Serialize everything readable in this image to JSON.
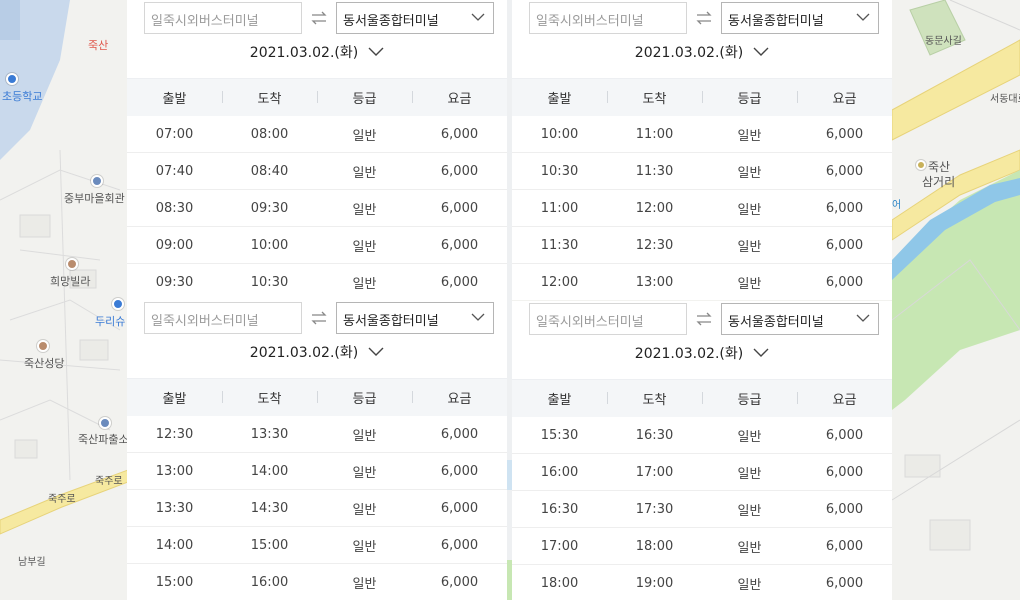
{
  "map": {
    "labels": {
      "school": "초등학교",
      "juksan_red": "죽산",
      "jungbu": "중부마을회관",
      "huimang": "희망빌라",
      "duri": "두리슈",
      "juksan_church": "죽산성당",
      "police": "죽산파출소",
      "jukju_ro_1": "죽주로",
      "jukju_ro_2": "죽주로",
      "nambu": "남부길",
      "dongmun": "동문사길",
      "seodong": "서동대로",
      "samgeori_1": "죽산",
      "samgeori_2": "삼거리",
      "eo": "어"
    }
  },
  "panels": [
    {
      "from_placeholder": "일죽시외버스터미널",
      "to_value": "동서울종합터미널",
      "date": "2021.03.02.(화)",
      "headers": [
        "출발",
        "도착",
        "등급",
        "요금"
      ],
      "rows": [
        [
          "07:00",
          "08:00",
          "일반",
          "6,000"
        ],
        [
          "07:40",
          "08:40",
          "일반",
          "6,000"
        ],
        [
          "08:30",
          "09:30",
          "일반",
          "6,000"
        ],
        [
          "09:00",
          "10:00",
          "일반",
          "6,000"
        ],
        [
          "09:30",
          "10:30",
          "일반",
          "6,000"
        ]
      ]
    },
    {
      "from_placeholder": "일죽시외버스터미널",
      "to_value": "동서울종합터미널",
      "date": "2021.03.02.(화)",
      "headers": [
        "출발",
        "도착",
        "등급",
        "요금"
      ],
      "rows": [
        [
          "10:00",
          "11:00",
          "일반",
          "6,000"
        ],
        [
          "10:30",
          "11:30",
          "일반",
          "6,000"
        ],
        [
          "11:00",
          "12:00",
          "일반",
          "6,000"
        ],
        [
          "11:30",
          "12:30",
          "일반",
          "6,000"
        ],
        [
          "12:00",
          "13:00",
          "일반",
          "6,000"
        ]
      ]
    },
    {
      "from_placeholder": "일죽시외버스터미널",
      "to_value": "동서울종합터미널",
      "date": "2021.03.02.(화)",
      "headers": [
        "출발",
        "도착",
        "등급",
        "요금"
      ],
      "rows": [
        [
          "12:30",
          "13:30",
          "일반",
          "6,000"
        ],
        [
          "13:00",
          "14:00",
          "일반",
          "6,000"
        ],
        [
          "13:30",
          "14:30",
          "일반",
          "6,000"
        ],
        [
          "14:00",
          "15:00",
          "일반",
          "6,000"
        ],
        [
          "15:00",
          "16:00",
          "일반",
          "6,000"
        ]
      ]
    },
    {
      "from_placeholder": "일죽시외버스터미널",
      "to_value": "동서울종합터미널",
      "date": "2021.03.02.(화)",
      "headers": [
        "출발",
        "도착",
        "등급",
        "요금"
      ],
      "rows": [
        [
          "15:30",
          "16:30",
          "일반",
          "6,000"
        ],
        [
          "16:00",
          "17:00",
          "일반",
          "6,000"
        ],
        [
          "16:30",
          "17:30",
          "일반",
          "6,000"
        ],
        [
          "17:00",
          "18:00",
          "일반",
          "6,000"
        ],
        [
          "18:00",
          "19:00",
          "일반",
          "6,000"
        ]
      ]
    }
  ],
  "icons": {
    "swap": "swap-arrows-icon",
    "dropdown": "chevron-down-icon"
  }
}
